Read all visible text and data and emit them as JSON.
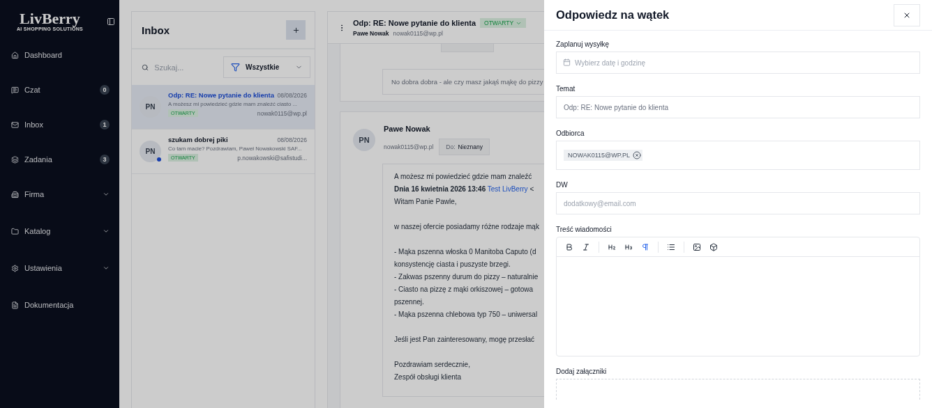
{
  "sidebar": {
    "logo": "LivBerry",
    "tagline": "AI SHOPPING SOLUTIONS",
    "items": [
      {
        "kind": "home",
        "label": "Dashboard"
      },
      {
        "kind": "chat",
        "label": "Czat",
        "count": "0"
      },
      {
        "kind": "mail",
        "label": "Inbox",
        "count": "1"
      },
      {
        "kind": "layers",
        "label": "Zadania",
        "count": "3"
      },
      {
        "kind": "building",
        "label": "Firma",
        "expandable": true
      },
      {
        "kind": "folder",
        "label": "Katalog",
        "expandable": true
      },
      {
        "kind": "gear",
        "label": "Ustawienia",
        "expandable": true
      },
      {
        "kind": "doc",
        "label": "Dokumentacja"
      }
    ]
  },
  "inbox": {
    "title": "Inbox",
    "search": {
      "placeholder": "Szukaj..."
    },
    "filter": "Wszystkie",
    "threads": [
      {
        "initials": "PN",
        "subject": "Odp: RE: Nowe pytanie do klienta",
        "date": "08/08/2026",
        "preview": "A możesz mi powiedzieć gdzie mam znaleźć ciasto ...",
        "status": "OTWARTY",
        "email": "nowak0115@wp.pl",
        "selected": true,
        "unread": false
      },
      {
        "initials": "PN",
        "subject": "szukam dobrej piki",
        "date": "08/08/2026",
        "preview": "Co tam macie? Pozdrawiam, Paweł Nowakowski SAF...",
        "status": "OTWARTY",
        "email": "p.nowakowski@safistudi...",
        "selected": false,
        "unread": true
      }
    ]
  },
  "thread": {
    "subject": "Odp: RE: Nowe pytanie do klienta",
    "status": "OTWARTY",
    "sender": "Pawe Nowak",
    "email": "nowak0115@wp.pl",
    "quoted": "No dobra dobra - ale czy masz jakąś mąkę do pizzy",
    "message": {
      "initials": "PN",
      "sender": "Pawe Nowak",
      "email": "nowak0115@wp.pl",
      "to_label": "Do:",
      "to": "Nieznany",
      "intro": "A możesz mi powiedzieć gdzie mam znaleźć",
      "quote_header": {
        "date": "Dnia 16 kwietnia 2026 13:46",
        "link": "Test LivBerry",
        "rest": "<"
      },
      "paragraphs": [
        [
          "Witam Panie Pawle,"
        ],
        [
          "w naszej ofercie posiadamy różne rodzaje mąk"
        ],
        [
          "- Mąka pszenna włoska 0 Manitoba Caputo (d",
          "konsystencję ciasta i puszyste brzegi.",
          "- Zakwas pszenny durum do pizzy – naturalnie",
          "- Ciasto na pizzę z mąki orkiszowej – gotowa",
          "pszennej.",
          "- Mąka pszenna chlebowa typ 750 – uniwersal"
        ],
        [
          "Jeśli jest Pan zainteresowany, mogę przesłać"
        ],
        [
          "Pozdrawiam serdecznie,",
          "Zespół obsługi klienta"
        ]
      ]
    }
  },
  "drawer": {
    "title": "Odpowiedz na wątek",
    "fields": [
      {
        "kind": "date",
        "label": "Zaplanuj wysyłkę",
        "placeholder": "Wybierz datę i godzinę"
      },
      {
        "kind": "text",
        "label": "Temat",
        "value": "Odp: RE: Nowe pytanie do klienta"
      },
      {
        "kind": "tags",
        "label": "Odbiorca",
        "tags": [
          "NOWAK0115@WP.PL"
        ]
      },
      {
        "kind": "text",
        "label": "DW",
        "placeholder": "dodatkowy@email.com"
      },
      {
        "kind": "editor",
        "label": "Treść wiadomości",
        "tools": [
          {
            "kind": "bold",
            "selected": false
          },
          {
            "kind": "italic",
            "selected": false
          },
          {
            "kind": "sep"
          },
          {
            "kind": "h2",
            "selected": false
          },
          {
            "kind": "h3",
            "selected": false
          },
          {
            "kind": "paragraph",
            "selected": true
          },
          {
            "kind": "sep"
          },
          {
            "kind": "list",
            "selected": false
          },
          {
            "kind": "sep"
          },
          {
            "kind": "image",
            "selected": false
          },
          {
            "kind": "box",
            "selected": false
          }
        ]
      },
      {
        "kind": "dropzone",
        "label": "Dodaj załączniki"
      }
    ]
  }
}
